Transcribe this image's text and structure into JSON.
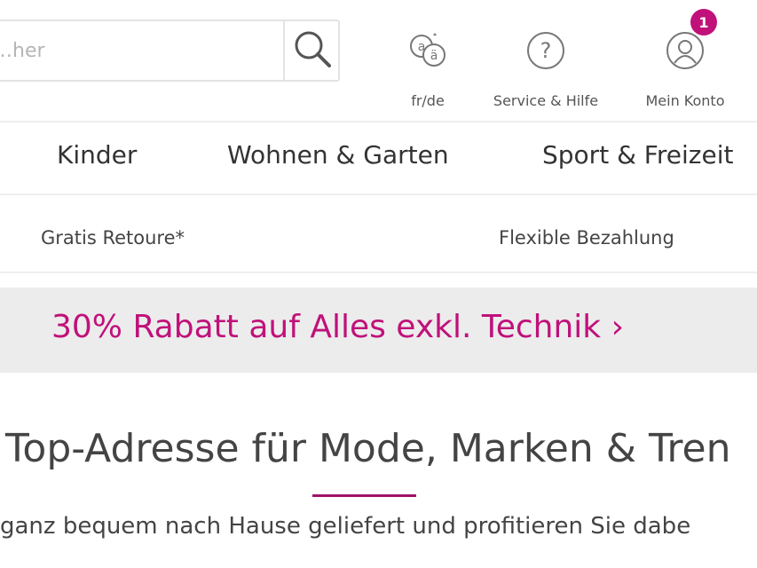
{
  "header": {
    "search": {
      "placeholder": "…her",
      "value": ""
    },
    "utilities": [
      {
        "label": "fr/de",
        "icon": "language-switch-icon"
      },
      {
        "label": "Service & Hilfe",
        "icon": "help-icon"
      },
      {
        "label": "Mein Konto",
        "icon": "account-icon",
        "badge": "1"
      }
    ]
  },
  "nav": {
    "items": [
      {
        "label": "Kinder"
      },
      {
        "label": "Wohnen & Garten"
      },
      {
        "label": "Sport & Freizeit"
      }
    ]
  },
  "benefits": [
    {
      "label": "Gratis Retoure*"
    },
    {
      "label": "Flexible Bezahlung"
    }
  ],
  "promo": {
    "text": "30% Rabatt auf Alles exkl. Technik ›"
  },
  "intro": {
    "headline": "Top-Adresse für Mode, Marken & Tren",
    "subtext": "ganz bequem nach Hause geliefert und profitieren Sie dabe"
  },
  "colors": {
    "accent": "#c0117a",
    "promo_bg": "#ececec",
    "divider": "#efefef"
  }
}
